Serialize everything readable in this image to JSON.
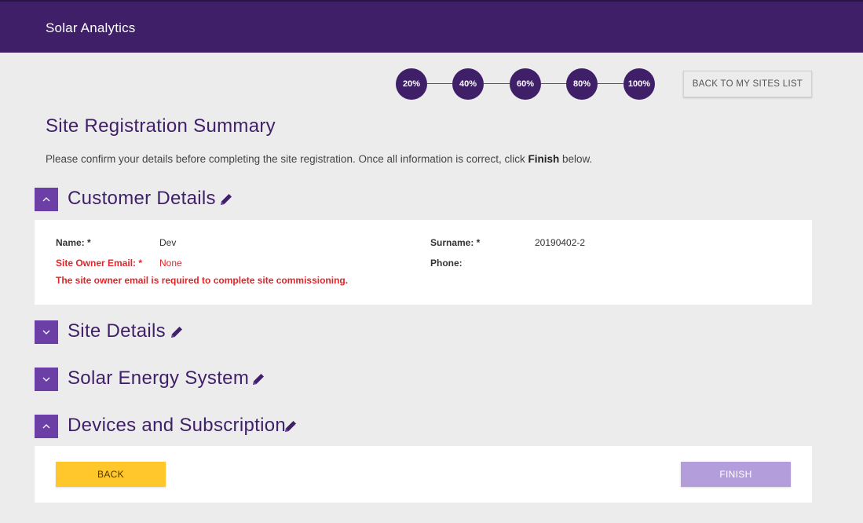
{
  "header": {
    "app_title": "Solar Analytics"
  },
  "progress": {
    "steps": [
      "20%",
      "40%",
      "60%",
      "80%",
      "100%"
    ],
    "back_to_sites_label": "BACK TO MY SITES LIST"
  },
  "page": {
    "title": "Site Registration Summary",
    "intro_before": "Please confirm your details before completing the site registration. Once all information is correct, click ",
    "intro_bold": "Finish",
    "intro_after": " below."
  },
  "sections": {
    "customer": {
      "title": "Customer Details",
      "expanded": true,
      "name_label": "Name: *",
      "name_value": "Dev",
      "surname_label": "Surname: *",
      "surname_value": "20190402-2",
      "email_label": "Site Owner Email: *",
      "email_value": "None",
      "phone_label": "Phone:",
      "phone_value": "",
      "error_message": "The site owner email is required to complete site commissioning."
    },
    "site": {
      "title": "Site Details",
      "expanded": false
    },
    "solar": {
      "title": "Solar Energy System",
      "expanded": false
    },
    "devices": {
      "title": "Devices and Subscription",
      "expanded": true
    }
  },
  "actions": {
    "back_label": "BACK",
    "finish_label": "FINISH"
  },
  "colors": {
    "brand": "#3f1f68",
    "accent": "#6b3fa6",
    "error": "#e0262b",
    "back_button": "#ffc72c",
    "finish_button": "#b49ddb"
  },
  "icons": {
    "collapse": "chevron-up-icon",
    "expand": "chevron-down-icon",
    "edit": "pencil-icon"
  }
}
